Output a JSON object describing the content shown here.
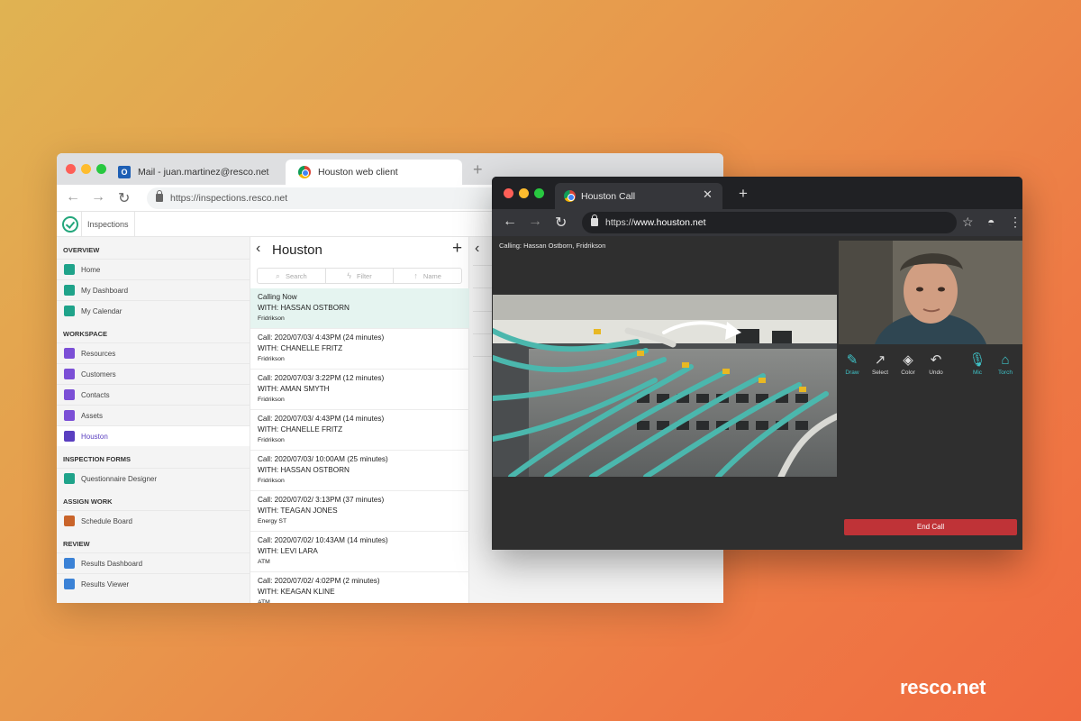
{
  "back_window": {
    "tabs": [
      {
        "label": "Mail - juan.martinez@resco.net",
        "icon": "outlook-icon"
      },
      {
        "label": "Houston web client",
        "icon": "chrome-icon"
      }
    ],
    "new_tab": "+",
    "url": "https://inspections.resco.net",
    "app_title": "Inspections",
    "sidebar": {
      "sections": [
        {
          "label": "OVERVIEW",
          "items": [
            {
              "label": "Home",
              "color": "#1fa38a"
            },
            {
              "label": "My Dashboard",
              "color": "#1fa38a"
            },
            {
              "label": "My Calendar",
              "color": "#1fa38a"
            }
          ]
        },
        {
          "label": "WORKSPACE",
          "items": [
            {
              "label": "Resources",
              "color": "#7b4fd6"
            },
            {
              "label": "Customers",
              "color": "#7b4fd6"
            },
            {
              "label": "Contacts",
              "color": "#7b4fd6"
            },
            {
              "label": "Assets",
              "color": "#7b4fd6"
            },
            {
              "label": "Houston",
              "color": "#5a3fc0",
              "active": true
            }
          ]
        },
        {
          "label": "INSPECTION FORMS",
          "items": [
            {
              "label": "Questionnaire Designer",
              "color": "#1fa38a"
            }
          ]
        },
        {
          "label": "ASSIGN WORK",
          "items": [
            {
              "label": "Schedule Board",
              "color": "#c9642a"
            }
          ]
        },
        {
          "label": "REVIEW",
          "items": [
            {
              "label": "Results Dashboard",
              "color": "#3b82d6"
            },
            {
              "label": "Results Viewer",
              "color": "#3b82d6"
            }
          ]
        }
      ]
    },
    "list": {
      "title": "Houston",
      "back": "‹",
      "add": "+",
      "tools": [
        {
          "label": "Search",
          "glyph": "⌕"
        },
        {
          "label": "Filter",
          "glyph": "ϟ"
        },
        {
          "label": "Name",
          "glyph": "↑"
        }
      ],
      "calls": [
        {
          "line1": "Calling Now",
          "line2": "WITH: HASSAN OSTBORN",
          "line3": "Fridrikson",
          "active": true
        },
        {
          "line1": "Call: 2020/07/03/ 4:43PM (24 minutes)",
          "line2": "WITH: CHANELLE FRITZ",
          "line3": "Fridrikson"
        },
        {
          "line1": "Call: 2020/07/03/ 3:22PM (12 minutes)",
          "line2": "WITH: AMAN SMYTH",
          "line3": "Fridrikson"
        },
        {
          "line1": "Call: 2020/07/03/ 4:43PM (14 minutes)",
          "line2": "WITH: CHANELLE FRITZ",
          "line3": "Fridrikson"
        },
        {
          "line1": "Call: 2020/07/03/ 10:00AM (25 minutes)",
          "line2": "WITH: HASSAN OSTBORN",
          "line3": "Fridrikson"
        },
        {
          "line1": "Call: 2020/07/02/ 3:13PM (37 minutes)",
          "line2": "WITH: TEAGAN JONES",
          "line3": "Energy ST"
        },
        {
          "line1": "Call: 2020/07/02/ 10:43AM (14 minutes)",
          "line2": "WITH: LEVI LARA",
          "line3": "ATM"
        },
        {
          "line1": "Call: 2020/07/02/ 4:02PM  (2 minutes)",
          "line2": "WITH: KEAGAN KLINE",
          "line3": "ATM"
        }
      ]
    }
  },
  "front_window": {
    "tab": "Houston Call",
    "close": "✕",
    "new_tab": "+",
    "url_scheme": "https://",
    "url_host": "www.houston.net",
    "calling_label": "Calling: Hassan Ostborn, Fridrikson",
    "tools": [
      {
        "label": "Draw",
        "glyph": "✎",
        "active": true
      },
      {
        "label": "Select",
        "glyph": "↗"
      },
      {
        "label": "Color",
        "glyph": "◈"
      },
      {
        "label": "Undo",
        "glyph": "↶"
      },
      {
        "label": "Mic",
        "glyph": "🎙",
        "active": true
      },
      {
        "label": "Torch",
        "glyph": "⌂",
        "active": true
      }
    ],
    "end_call": "End Call"
  },
  "brand": "resco.net"
}
